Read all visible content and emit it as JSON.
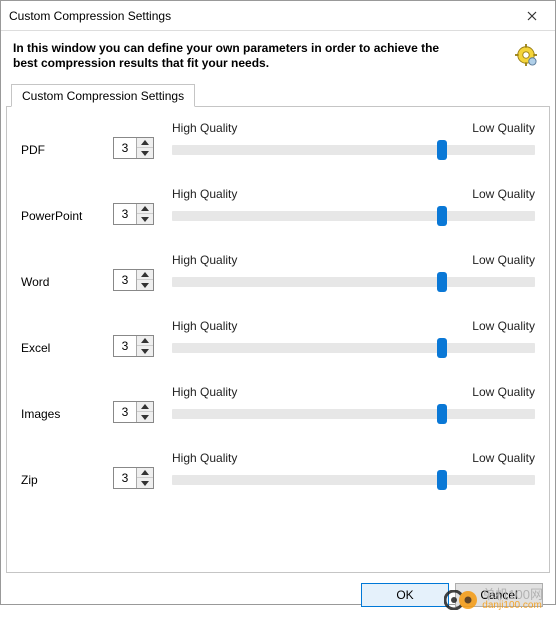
{
  "window": {
    "title": "Custom Compression Settings",
    "intro": "In this window you can define your own parameters in order to achieve the best compression results that fit your needs."
  },
  "tabs": [
    {
      "label": "Custom Compression Settings"
    }
  ],
  "slider": {
    "high_label": "High Quality",
    "low_label": "Low Quality",
    "min": 1,
    "max": 5
  },
  "rows": [
    {
      "label": "PDF",
      "value": 3,
      "slider": 4
    },
    {
      "label": "PowerPoint",
      "value": 3,
      "slider": 4
    },
    {
      "label": "Word",
      "value": 3,
      "slider": 4
    },
    {
      "label": "Excel",
      "value": 3,
      "slider": 4
    },
    {
      "label": "Images",
      "value": 3,
      "slider": 4
    },
    {
      "label": "Zip",
      "value": 3,
      "slider": 4
    }
  ],
  "footer": {
    "ok": "OK",
    "cancel": "Cancel"
  },
  "watermark": {
    "text_cn": "单机100网",
    "text_url": "danji100.com"
  }
}
